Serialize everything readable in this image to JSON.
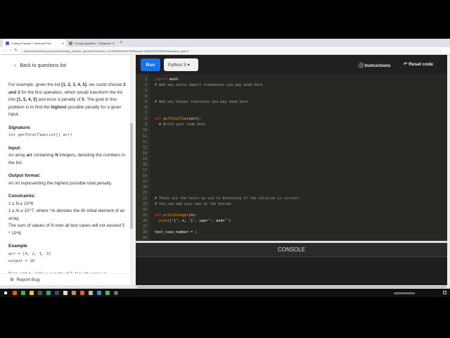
{
  "browser": {
    "tabs": [
      {
        "label": "Coding Practice | Facebook Rec"
      },
      {
        "label": "Greedy algorithm - Wikipedia"
      }
    ],
    "url": "facebookrecruiting.com/portal/coding_practice_question/?problem_id=559324704673058&ppid=454615229006519&practice_plan=0"
  },
  "left": {
    "back_label": "Back to questions list",
    "intro_1": "For example, given the list ",
    "intro_list1": "[1, 2, 3, 4, 5]",
    "intro_2": ", we could choose ",
    "intro_23": "2 and 3",
    "intro_3": " for the first operation, which would transform the list into ",
    "intro_list2": "[1, 5, 4, 5]",
    "intro_4": " and incur a penalty of ",
    "intro_5": "5",
    "intro_6": ". The goal in this problem is to find the ",
    "intro_highest": "highest",
    "intro_7": " possible penalty for a given input.",
    "signature_title": "Signature:",
    "signature": "int getTotalTime(int[] arr)",
    "input_title": "Input:",
    "input_1": "An array ",
    "input_arr": "arr",
    "input_2": " containing ",
    "input_n": "N",
    "input_3": " integers, denoting the numbers in the list.",
    "output_title": "Output format:",
    "output_text": "An int representing the highest possible total penalty.",
    "constraints_title": "Constraints:",
    "constraint_1": "1 ≤ N ≤ 10^6",
    "constraint_2": "1 ≤ Ai ≤ 10^7, where *Ai denotes the ith initial element of an array.",
    "constraint_3": "The sum of values of N over all test cases will not exceed 5 * 10^6.",
    "example_title": "Example",
    "example_arr": "arr = [4, 2, 1, 3]",
    "example_output": "output = 26",
    "example_cut": "First, add 4 + 3 for a penalty of 7. Now the array is",
    "report_bug": "Report Bug"
  },
  "editor": {
    "run_label": "Run",
    "language": "Python 3",
    "instructions_label": "Instructions",
    "reset_label": "Reset code",
    "console_label": "CONSOLE",
    "lines": [
      {
        "n": "1",
        "t": "import math"
      },
      {
        "n": "2",
        "t": "# Add any extra import statements you may need here"
      },
      {
        "n": "3",
        "t": ""
      },
      {
        "n": "4",
        "t": ""
      },
      {
        "n": "5",
        "t": "# Add any helper functions you may need here"
      },
      {
        "n": "6",
        "t": ""
      },
      {
        "n": "7",
        "t": ""
      },
      {
        "n": "8",
        "t": "def getTotalTime(arr):"
      },
      {
        "n": "9",
        "t": "  # Write your code here"
      },
      {
        "n": "10",
        "t": ""
      },
      {
        "n": "11",
        "t": ""
      },
      {
        "n": "12",
        "t": ""
      },
      {
        "n": "13",
        "t": ""
      },
      {
        "n": "14",
        "t": ""
      },
      {
        "n": "15",
        "t": ""
      },
      {
        "n": "16",
        "t": ""
      },
      {
        "n": "17",
        "t": ""
      },
      {
        "n": "18",
        "t": ""
      },
      {
        "n": "19",
        "t": ""
      },
      {
        "n": "20",
        "t": ""
      },
      {
        "n": "21",
        "t": ""
      },
      {
        "n": "22",
        "t": "# These are the tests we use to determine if the solution is correct."
      },
      {
        "n": "23",
        "t": "# You can add your own at the bottom."
      },
      {
        "n": "24",
        "t": ""
      },
      {
        "n": "25",
        "t": "def printInteger(n):"
      },
      {
        "n": "26",
        "t": "  print('[', n, ']', sep='', end='')"
      },
      {
        "n": "27",
        "t": ""
      },
      {
        "n": "28",
        "t": "test_case_number = 1"
      },
      {
        "n": "29",
        "t": ""
      }
    ]
  }
}
